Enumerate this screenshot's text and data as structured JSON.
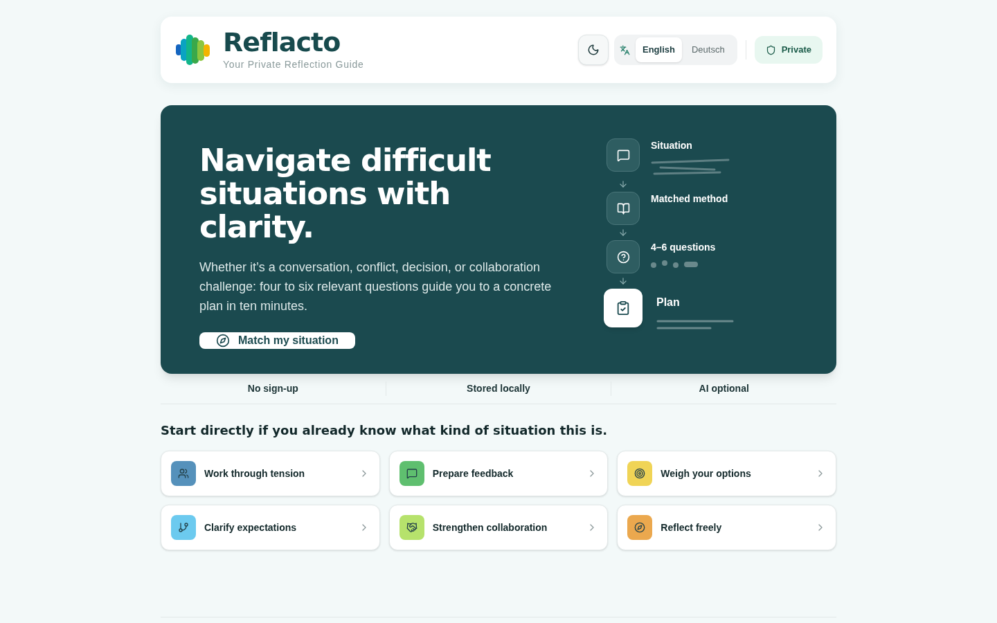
{
  "header": {
    "brand": "Reflacto",
    "tagline": "Your Private Reflection Guide",
    "languages": [
      {
        "label": "English",
        "selected": true
      },
      {
        "label": "Deutsch",
        "selected": false
      }
    ],
    "privacy_badge": "Private"
  },
  "hero": {
    "title_lines": [
      "Navigate difficult",
      "situations with clarity."
    ],
    "text": "Whether it’s a conversation, conflict, decision, or collaboration challenge: four to six relevant questions guide you to a concrete plan in ten minutes.",
    "cta": "Match my situation",
    "steps": [
      {
        "label": "Situation",
        "kind": "step"
      },
      {
        "label": "Matched method",
        "kind": "step"
      },
      {
        "label": "4–6 questions",
        "kind": "step"
      },
      {
        "label": "Plan",
        "kind": "result"
      }
    ]
  },
  "features": [
    "No sign-up",
    "Stored locally",
    "AI optional"
  ],
  "quick_start": {
    "heading": "Start directly if you already know what kind of situation this is.",
    "situations": [
      {
        "label": "Work through tension",
        "color": "#5591bb"
      },
      {
        "label": "Prepare feedback",
        "color": "#5fbf6f"
      },
      {
        "label": "Weigh your options",
        "color": "#f0d456"
      },
      {
        "label": "Clarify expectations",
        "color": "#6ccaef"
      },
      {
        "label": "Strengthen collaboration",
        "color": "#b6e26c"
      },
      {
        "label": "Reflect freely",
        "color": "#eba84e"
      }
    ]
  }
}
